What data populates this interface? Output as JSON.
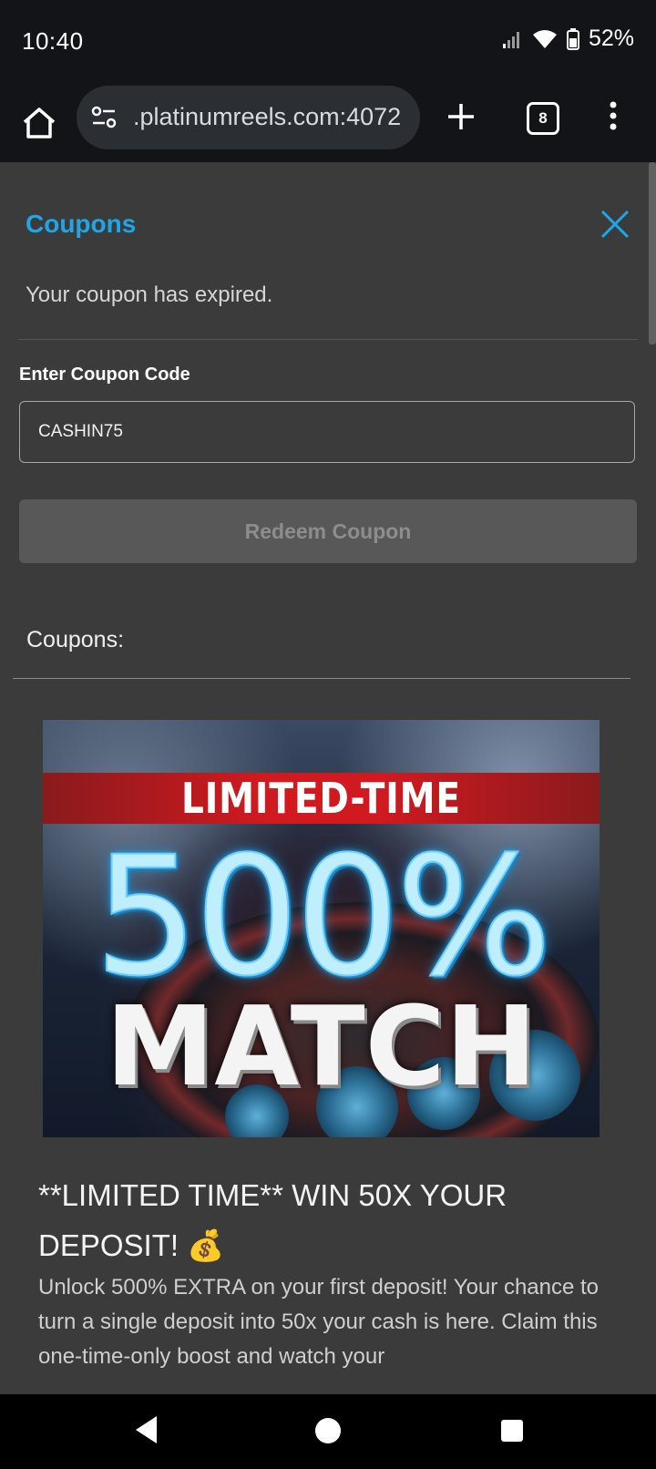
{
  "status_bar": {
    "time": "10:40",
    "battery": "52%"
  },
  "browser": {
    "url": ".platinumreels.com:4072",
    "tab_count": "8"
  },
  "modal": {
    "title": "Coupons",
    "message": "Your coupon has expired.",
    "input_label": "Enter Coupon Code",
    "input_value": "CASHIN75",
    "redeem_label": "Redeem Coupon",
    "list_heading": "Coupons:"
  },
  "promo": {
    "banner_top": "LIMITED-TIME",
    "banner_big": "500%",
    "banner_bottom": "MATCH",
    "headline": "**LIMITED TIME** WIN 50X YOUR DEPOSIT! 💰",
    "body": "Unlock 500% EXTRA on your first deposit! Your chance to turn a single deposit into 50x your cash is here. Claim this one-time-only boost and watch your"
  },
  "colors": {
    "accent": "#1da7e6",
    "background": "#3b3b3b",
    "bar": "#121417"
  },
  "icons": [
    "home-icon",
    "site-settings-icon",
    "new-tab-icon",
    "tab-switcher-icon",
    "more-menu-icon",
    "close-icon",
    "back-icon",
    "home-nav-icon",
    "recents-icon",
    "signal-icon",
    "wifi-icon",
    "battery-icon"
  ]
}
